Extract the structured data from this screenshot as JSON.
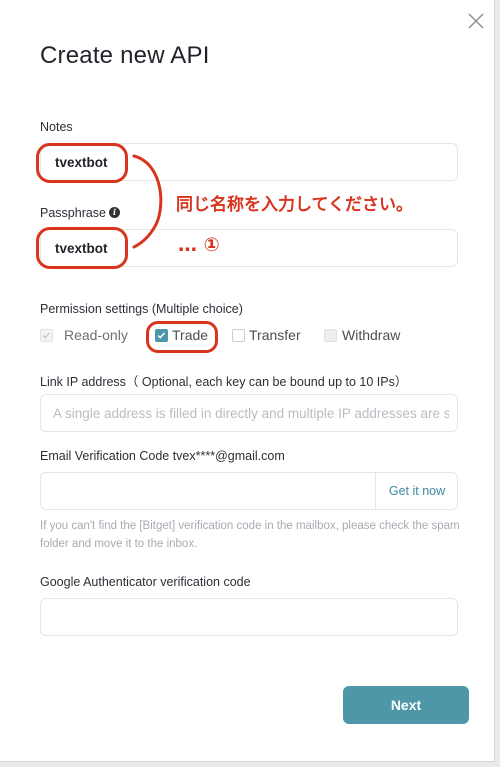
{
  "dialog": {
    "title": "Create new API"
  },
  "notes": {
    "label": "Notes",
    "value": "tvextbot"
  },
  "passphrase": {
    "label": "Passphrase",
    "value": "tvextbot"
  },
  "annotation": {
    "instruction": "同じ名称を入力してください。",
    "step_marker": "… ①",
    "color": "#d9341e"
  },
  "permissions": {
    "label": "Permission settings (Multiple choice)",
    "options": [
      {
        "label": "Read-only",
        "checked": true,
        "disabled": true
      },
      {
        "label": "Trade",
        "checked": true,
        "disabled": false
      },
      {
        "label": "Transfer",
        "checked": false,
        "disabled": false
      },
      {
        "label": "Withdraw",
        "checked": false,
        "disabled": true
      }
    ]
  },
  "link_ip": {
    "label": "Link IP address（ Optional, each key can be bound up to 10 IPs）",
    "placeholder": "A single address is filled in directly and multiple IP addresses are separated by commas"
  },
  "email_code": {
    "label": "Email Verification Code tvex****@gmail.com",
    "value": "",
    "get_code_label": "Get it now",
    "hint": "If you can't find the [Bitget] verification code in the mailbox, please check the spam folder and move it to the inbox."
  },
  "google_auth": {
    "label": "Google Authenticator verification code",
    "value": ""
  },
  "footer": {
    "next_label": "Next",
    "accent_color": "#4d97a8"
  }
}
